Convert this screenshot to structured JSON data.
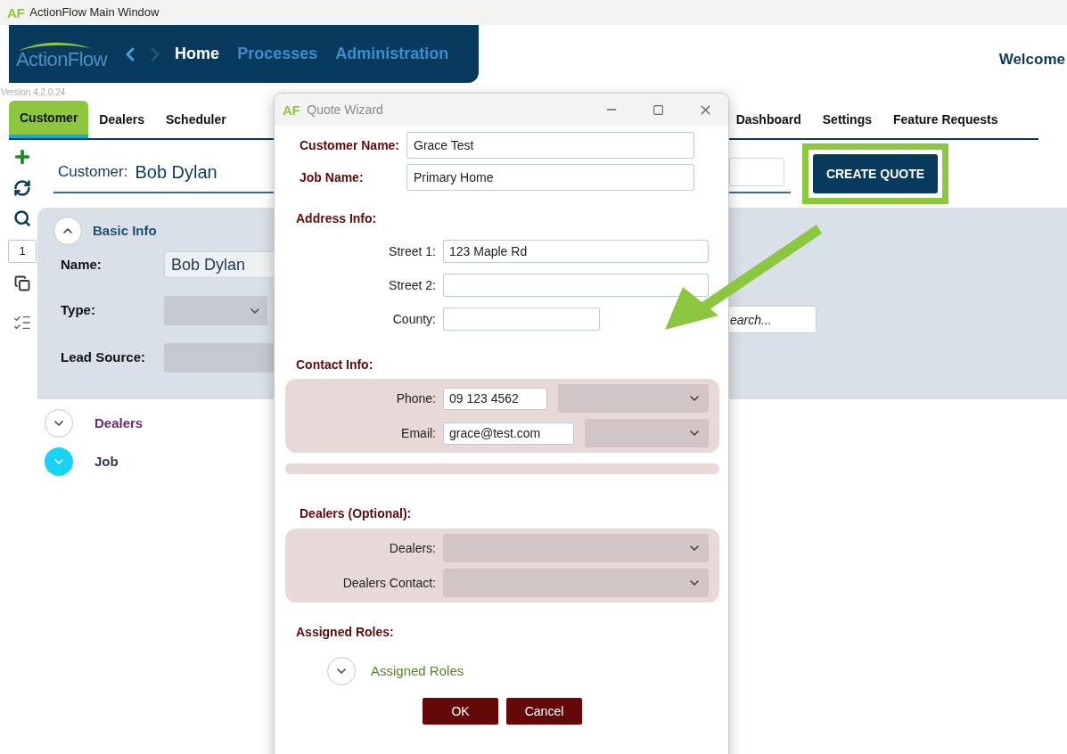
{
  "window": {
    "title": "ActionFlow Main Window",
    "mark": "AF"
  },
  "header": {
    "logo": "ActionFlow",
    "welcome": "Welcome",
    "version": "Version 4.2.0.24",
    "nav": [
      {
        "label": "Home",
        "selected": true
      },
      {
        "label": "Processes",
        "selected": false
      },
      {
        "label": "Administration",
        "selected": false
      }
    ]
  },
  "tabs": [
    {
      "label": "Customer",
      "selected": true,
      "gap_before": false
    },
    {
      "label": "Dealers",
      "selected": false,
      "gap_before": false
    },
    {
      "label": "Scheduler",
      "selected": false,
      "gap_before": false
    },
    {
      "label": "Dashboard",
      "selected": false,
      "gap_before": true
    },
    {
      "label": "Settings",
      "selected": false,
      "gap_before": false
    },
    {
      "label": "Feature Requests",
      "selected": false,
      "gap_before": false
    }
  ],
  "toolbar": {
    "page": "1"
  },
  "customer": {
    "label": "Customer:",
    "name": "Bob Dylan",
    "action": "CREATE QUOTE"
  },
  "basic_info": {
    "title": "Basic Info",
    "expanded": true,
    "search_placeholder": "earch...",
    "fields": [
      {
        "label": "Name:",
        "kind": "text",
        "value": "Bob Dylan"
      },
      {
        "label": "Type:",
        "kind": "dropdown"
      },
      {
        "label": "Lead Source:",
        "kind": "blank"
      }
    ]
  },
  "sections": [
    {
      "title": "Dealers",
      "expanded": false,
      "active": false
    },
    {
      "title": "Job",
      "expanded": false,
      "active": true
    }
  ],
  "dialog": {
    "title": "Quote Wizard",
    "mark": "AF",
    "fields": [
      {
        "label": "Customer Name:",
        "value": "Grace Test"
      },
      {
        "label": "Job Name:",
        "value": "Primary Home"
      }
    ],
    "address": {
      "title": "Address Info:",
      "fields": [
        {
          "label": "Street 1:",
          "kind": "wide",
          "value": "123 Maple Rd"
        },
        {
          "label": "Street 2:",
          "kind": "wide"
        },
        {
          "label": "County:",
          "kind": "short"
        }
      ]
    },
    "contact": {
      "title": "Contact Info:",
      "fields": [
        {
          "label": "Phone:",
          "kind": "phone",
          "value": "09 123 4562"
        },
        {
          "label": "Email:",
          "kind": "email",
          "value": "grace@test.com"
        }
      ]
    },
    "dealers": {
      "title": "Dealers (Optional):",
      "fields": [
        {
          "label": "Dealers:"
        },
        {
          "label": "Dealers Contact:"
        }
      ]
    },
    "roles": {
      "title": "Assigned Roles:",
      "expander": "Assigned Roles",
      "expanded": false
    },
    "buttons": [
      "OK",
      "Cancel"
    ]
  }
}
